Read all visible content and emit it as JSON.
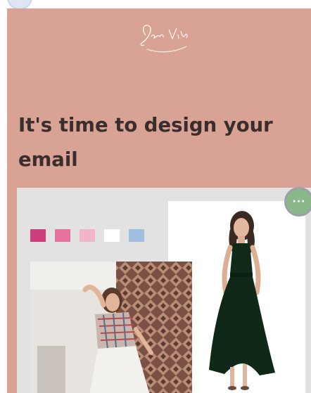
{
  "header": {
    "logo_text": "Jenii Vibe"
  },
  "hero": {
    "headline": "It's time to design your email"
  },
  "palette": {
    "swatches": [
      "#cc3f7a",
      "#e8709f",
      "#f2b4c8",
      "#ffffff",
      "#9fbee0"
    ]
  },
  "toolbar": {
    "more_glyph": "···"
  },
  "colors": {
    "panel_bg": "#d8a294",
    "card_bg": "#e2e2e2",
    "headline": "#3a2e2c",
    "accent_button": "#8ab88a"
  }
}
